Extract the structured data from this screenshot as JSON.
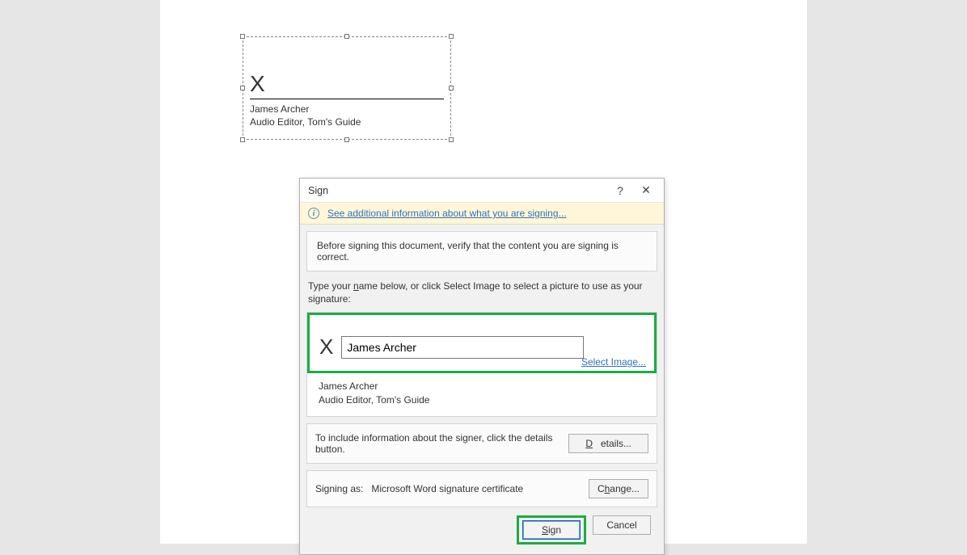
{
  "signature_block": {
    "x_mark": "X",
    "signer_name": "James Archer",
    "signer_title": "Audio Editor, Tom's Guide"
  },
  "dialog": {
    "title": "Sign",
    "help_glyph": "?",
    "close_glyph": "✕",
    "info_link": "See additional information about what you are signing...",
    "verify_text": "Before signing this document, verify that the content you are signing is correct.",
    "type_instr_pre": "Type your ",
    "type_instr_under": "n",
    "type_instr_post": "ame below, or click Select Image to select a picture to use as your signature:",
    "x_mark": "X",
    "name_value": "James Archer",
    "select_image": "Select Image...",
    "signer_name": "James Archer",
    "signer_title": "Audio Editor, Tom's Guide",
    "details_text": "To include information about the signer, click the details button.",
    "details_pre": "",
    "details_u": "D",
    "details_post": "etails...",
    "signing_as_label": "Signing as:",
    "signing_as_value": "Microsoft Word signature certificate",
    "change_pre": "C",
    "change_u": "h",
    "change_post": "ange...",
    "sign_u": "S",
    "sign_post": "ign",
    "cancel": "Cancel"
  }
}
